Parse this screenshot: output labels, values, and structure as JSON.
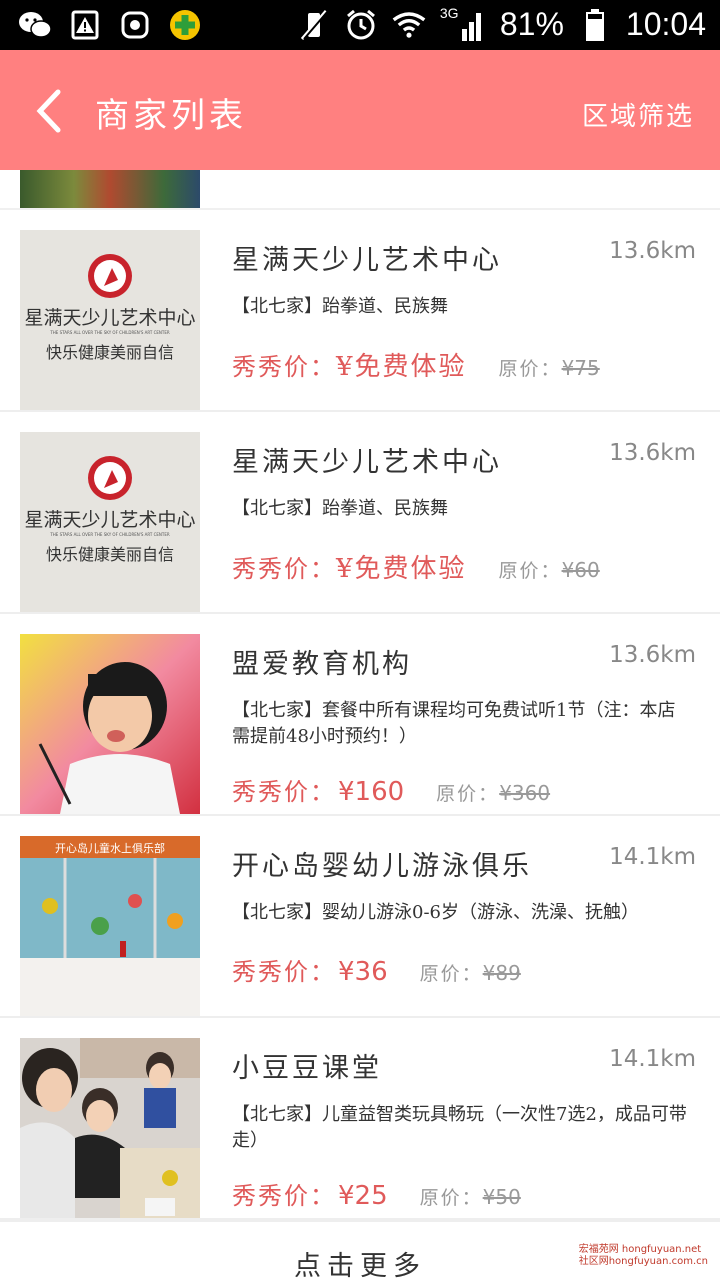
{
  "status_bar": {
    "battery_percent": "81%",
    "time": "10:04",
    "network": "3G",
    "icons": [
      "wechat-icon",
      "warning-icon",
      "app-icon",
      "plus-app-icon",
      "mute-icon",
      "alarm-icon",
      "wifi-icon",
      "signal-icon",
      "battery-icon"
    ]
  },
  "header": {
    "title": "商家列表",
    "filter_label": "区域筛选",
    "background": "#ff8080"
  },
  "merchants": [
    {
      "name": "星满天少儿艺术中心",
      "distance": "13.6km",
      "description": "【北七家】跆拳道、民族舞",
      "price_label": "秀秀价：",
      "price": "¥免费体验",
      "original_label": "原价：",
      "original_price": "¥75",
      "thumb": "art-center-logo"
    },
    {
      "name": "星满天少儿艺术中心",
      "distance": "13.6km",
      "description": "【北七家】跆拳道、民族舞",
      "price_label": "秀秀价：",
      "price": "¥免费体验",
      "original_label": "原价：",
      "original_price": "¥60",
      "thumb": "art-center-logo"
    },
    {
      "name": "盟爱教育机构",
      "distance": "13.6km",
      "description": "【北七家】套餐中所有课程均可免费试听1节（注：本店需提前48小时预约！）",
      "price_label": "秀秀价：",
      "price": "¥160",
      "original_label": "原价：",
      "original_price": "¥360",
      "thumb": "child-painting-photo"
    },
    {
      "name": "开心岛婴幼儿游泳俱乐",
      "distance": "14.1km",
      "description": "【北七家】婴幼儿游泳0-6岁（游泳、洗澡、抚触）",
      "price_label": "秀秀价：",
      "price": "¥36",
      "original_label": "原价：",
      "original_price": "¥89",
      "thumb": "swim-club-storefront"
    },
    {
      "name": "小豆豆课堂",
      "distance": "14.1km",
      "description": "【北七家】儿童益智类玩具畅玩（一次性7选2，成品可带走）",
      "price_label": "秀秀价：",
      "price": "¥25",
      "original_label": "原价：",
      "original_price": "¥50",
      "thumb": "kids-playing-photo"
    }
  ],
  "thumb_logo_text": {
    "big": "星满天少儿艺术中心",
    "small": "THE STARS ALL OVER THE SKY OF CHILDREN'S ART CENTER",
    "slogan": "快乐健康美丽自信"
  },
  "swim_sign_text": "开心岛儿童水上俱乐部",
  "load_more": "点击更多",
  "watermark": {
    "line1": "宏福苑网 hongfuyuan.net",
    "line2": "社区网hongfuyuan.com.cn"
  }
}
